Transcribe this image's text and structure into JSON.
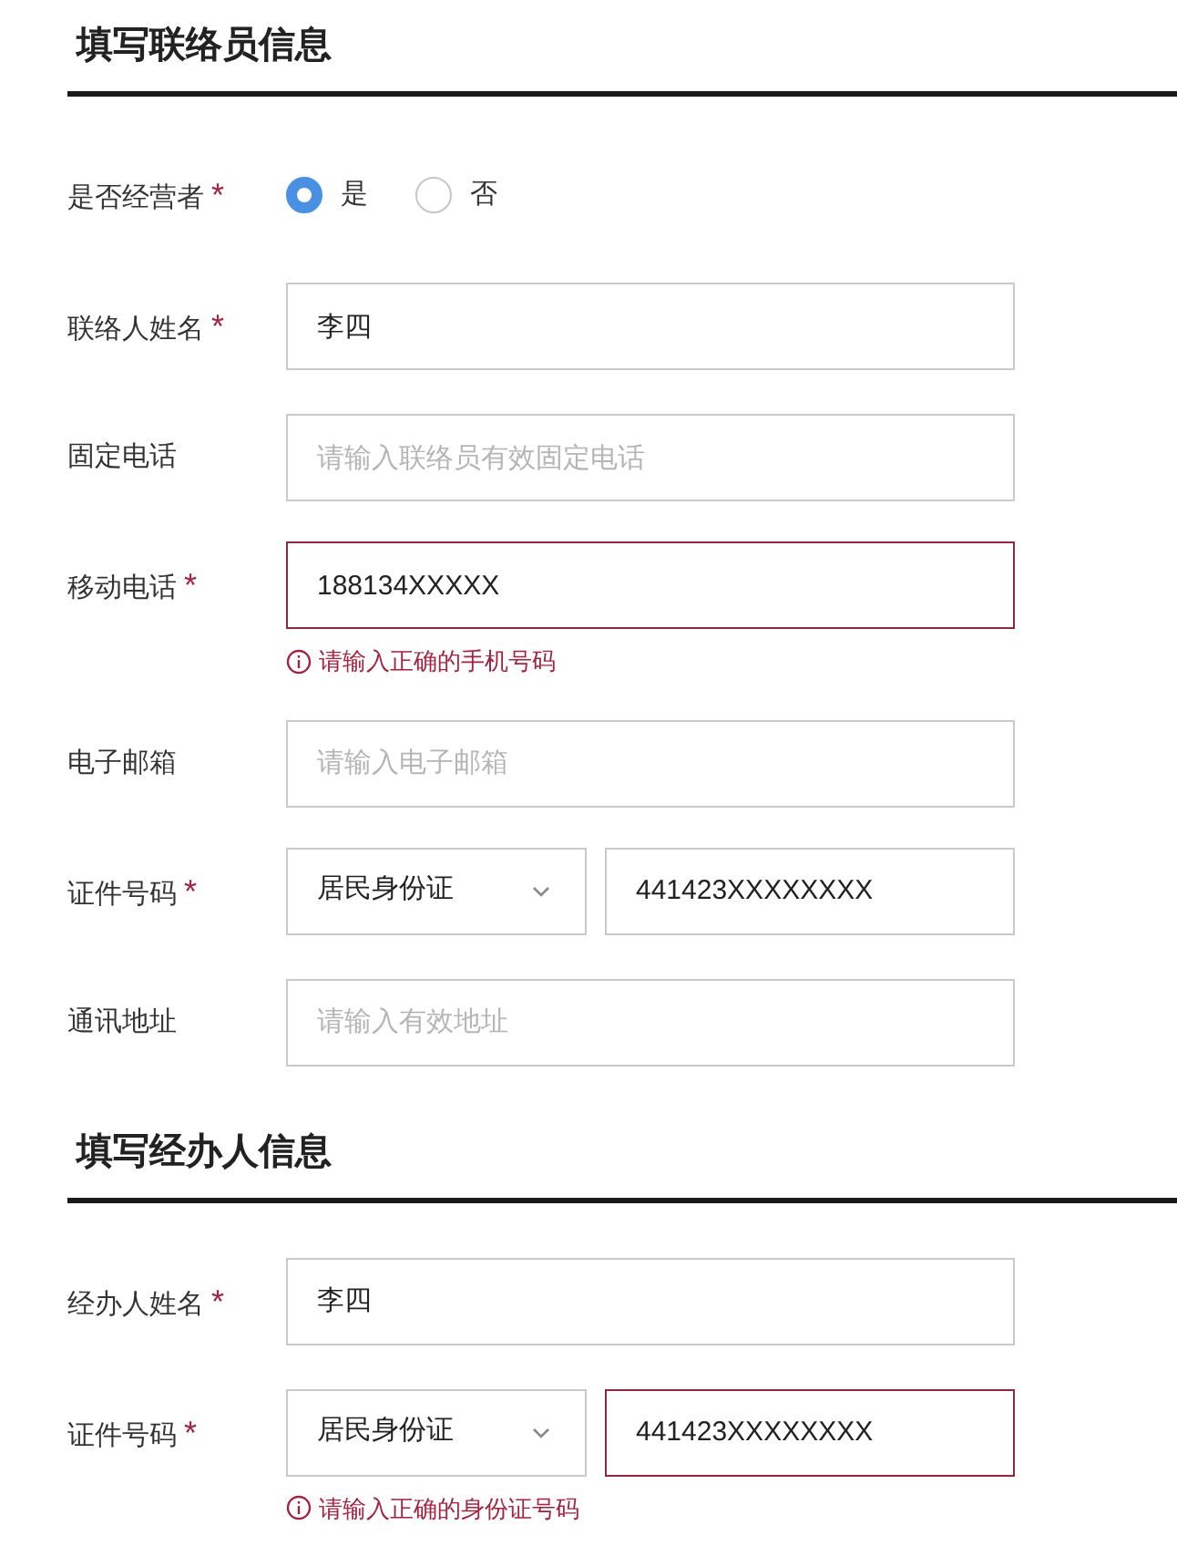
{
  "sections": [
    {
      "title": "填写联络员信息",
      "fields": [
        {
          "kind": "radio",
          "label": "是否经营者",
          "required_mark": "*",
          "options": [
            {
              "label": "是",
              "selected": true
            },
            {
              "label": "否",
              "selected": false
            }
          ]
        },
        {
          "kind": "text",
          "label": "联络人姓名",
          "required_mark": "*",
          "value": "李四",
          "invalid": false
        },
        {
          "kind": "text",
          "label": "固定电话",
          "placeholder": "请输入联络员有效固定电话",
          "invalid": false
        },
        {
          "kind": "text",
          "label": "移动电话",
          "required_mark": "*",
          "value": "188134XXXXX",
          "invalid": true,
          "error": "请输入正确的手机号码"
        },
        {
          "kind": "text",
          "label": "电子邮箱",
          "placeholder": "请输入电子邮箱",
          "invalid": false
        },
        {
          "kind": "id",
          "label": "证件号码",
          "required_mark": "*",
          "select": "居民身份证",
          "value": "441423XXXXXXXX",
          "invalid": false
        },
        {
          "kind": "text",
          "label": "通讯地址",
          "placeholder": "请输入有效地址",
          "invalid": false
        }
      ]
    },
    {
      "title": "填写经办人信息",
      "fields": [
        {
          "kind": "text",
          "label": "经办人姓名",
          "required_mark": "*",
          "value": "李四",
          "invalid": false
        },
        {
          "kind": "id",
          "label": "证件号码",
          "required_mark": "*",
          "select": "居民身份证",
          "value": "441423XXXXXXXX",
          "invalid": true,
          "error": "请输入正确的身份证号码"
        }
      ]
    }
  ]
}
